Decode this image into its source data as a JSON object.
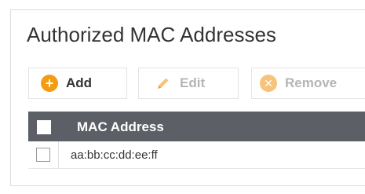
{
  "title": "Authorized MAC Addresses",
  "toolbar": {
    "add_label": "Add",
    "edit_label": "Edit",
    "remove_label": "Remove",
    "add_icon": "plus-circle-icon",
    "edit_icon": "pencil-icon",
    "remove_icon": "x-circle-icon"
  },
  "table": {
    "columns": [
      "MAC Address"
    ],
    "rows": [
      {
        "mac": "aa:bb:cc:dd:ee:ff",
        "selected": false
      }
    ]
  },
  "colors": {
    "accent": "#f39c12",
    "header_bg": "#5c5f66",
    "disabled_text": "#b5b5b5"
  }
}
